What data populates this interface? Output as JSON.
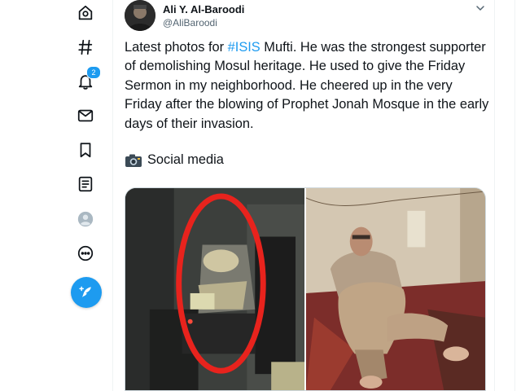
{
  "sidebar": {
    "items": [
      {
        "name": "communities-icon"
      },
      {
        "name": "explore-icon"
      },
      {
        "name": "notifications-icon",
        "badge": "2"
      },
      {
        "name": "messages-icon"
      },
      {
        "name": "bookmarks-icon"
      },
      {
        "name": "lists-icon"
      },
      {
        "name": "profile-icon"
      },
      {
        "name": "more-icon"
      }
    ],
    "compose_icon": "compose-tweet-icon"
  },
  "tweet": {
    "author_name": "Ali Y. Al-Baroodi",
    "author_handle": "@AliBaroodi",
    "text_before": "Latest photos for ",
    "hashtag": "#ISIS",
    "text_after": " Mufti. He was the strongest supporter of demolishing Mosul heritage. He used to give the Friday Sermon in my neighborhood. He cheered up in the very Friday after the blowing of Prophet Jonah Mosque in the early days of their invasion.",
    "media_caption": "Social media",
    "media_caption_icon": "camera-emoji"
  },
  "colors": {
    "accent": "#1d9bf0",
    "text": "#0f1419",
    "muted": "#536471",
    "annotation_red": "#e8231d"
  }
}
